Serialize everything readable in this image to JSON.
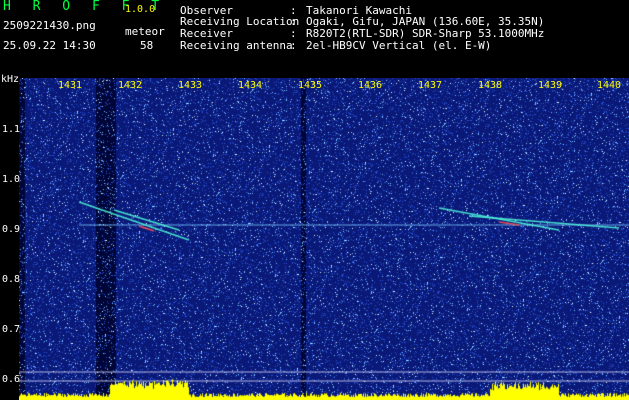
{
  "header": {
    "app_title": "H R O F F T",
    "version": "1.0.0",
    "filename": "2509221430.png",
    "datetime": "25.09.22 14:30",
    "meteor_label": "meteor",
    "meteor_count": "58"
  },
  "info": [
    {
      "key": "Observer",
      "sep": ":",
      "value": "Takanori Kawachi"
    },
    {
      "key": "Receiving Location",
      "sep": ":",
      "value": "Ogaki, Gifu, JAPAN (136.60E, 35.35N)"
    },
    {
      "key": "Receiver",
      "sep": ":",
      "value": "R820T2(RTL-SDR) SDR-Sharp 53.1000MHz"
    },
    {
      "key": "Receiving antenna",
      "sep": ":",
      "value": "2el-HB9CV Vertical (el. E-W)"
    }
  ],
  "axes": {
    "y_unit": "kHz",
    "x_ticks": [
      "1431",
      "1432",
      "1433",
      "1434",
      "1435",
      "1436",
      "1437",
      "1438",
      "1439",
      "1440"
    ],
    "y_ticks": [
      "1.1",
      "1.0",
      "0.9",
      "0.8",
      "0.7",
      "0.6"
    ]
  },
  "colors": {
    "background": "#000000",
    "spectrogram_base": "#0a1a8c",
    "accent_title": "#00ff40",
    "tick_x": "#ffff00",
    "signal_line": "#40e0ff",
    "bottom_bars": "#ffff00"
  }
}
